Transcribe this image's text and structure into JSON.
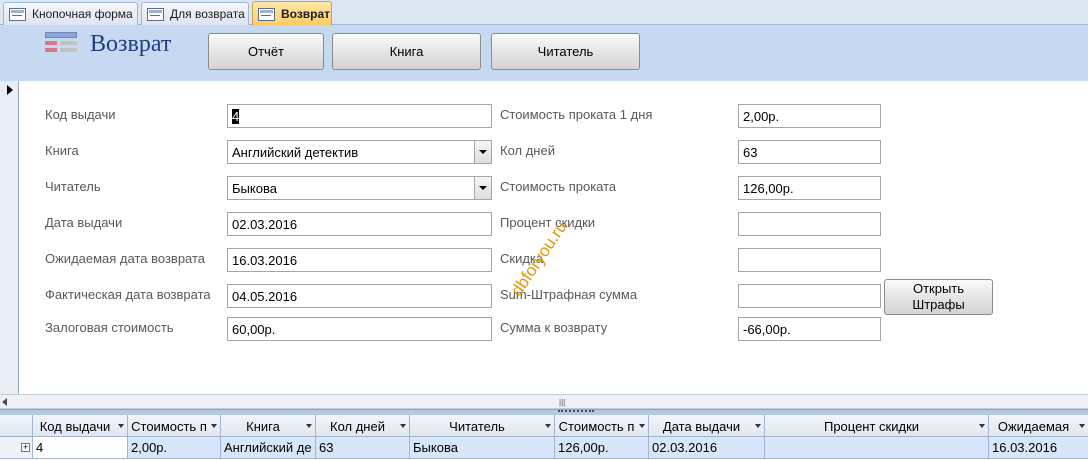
{
  "tabs": [
    {
      "label": "Кнопочная форма"
    },
    {
      "label": "Для возврата"
    },
    {
      "label": "Возврат"
    }
  ],
  "header": {
    "title": "Возврат",
    "buttons": [
      "Отчёт",
      "Книга",
      "Читатель"
    ]
  },
  "fields_left": [
    {
      "label": "Код выдачи",
      "value": "4"
    },
    {
      "label": "Книга",
      "value": "Английский детектив"
    },
    {
      "label": "Читатель",
      "value": "Быкова"
    },
    {
      "label": "Дата выдачи",
      "value": "02.03.2016"
    },
    {
      "label": "Ожидаемая дата возврата",
      "value": "16.03.2016"
    },
    {
      "label": "Фактическая дата возврата",
      "value": "04.05.2016"
    },
    {
      "label": "Залоговая стоимость",
      "value": "60,00р."
    }
  ],
  "fields_right": [
    {
      "label": "Стоимость проката 1 дня",
      "value": "2,00р."
    },
    {
      "label": "Кол дней",
      "value": "63"
    },
    {
      "label": "Стоимость проката",
      "value": "126,00р."
    },
    {
      "label": "Процент скидки",
      "value": ""
    },
    {
      "label": "Скидка",
      "value": ""
    },
    {
      "label": "Sum-Штрафная сумма",
      "value": ""
    },
    {
      "label": "Сумма к возврату",
      "value": "-66,00р."
    }
  ],
  "open_fines_button": {
    "line1": "Открыть",
    "line2": "Штрафы"
  },
  "watermark": "dbforyou.ru",
  "datasheet": {
    "columns": [
      "Код выдачи",
      "Стоимость п",
      "Книга",
      "Кол дней",
      "Читатель",
      "Стоимость п",
      "Дата выдачи",
      "Процент скидки",
      "Ожидаемая"
    ],
    "rows": [
      [
        "4",
        "2,00р.",
        "Английский де",
        "63",
        "Быкова",
        "126,00р.",
        "02.03.2016",
        "",
        "16.03.2016"
      ]
    ]
  },
  "icons": {
    "form": "form-icon",
    "expand": "expand-plus-icon",
    "record_pointer": "record-selector-arrow-icon",
    "dropdown": "chevron-down-icon"
  },
  "colors": {
    "header_bg": "#c6d9f1",
    "active_tab": "#ffcb63",
    "title": "#1f3f7f",
    "watermark": "#e69500",
    "selected_row": "#d7e6f8"
  }
}
